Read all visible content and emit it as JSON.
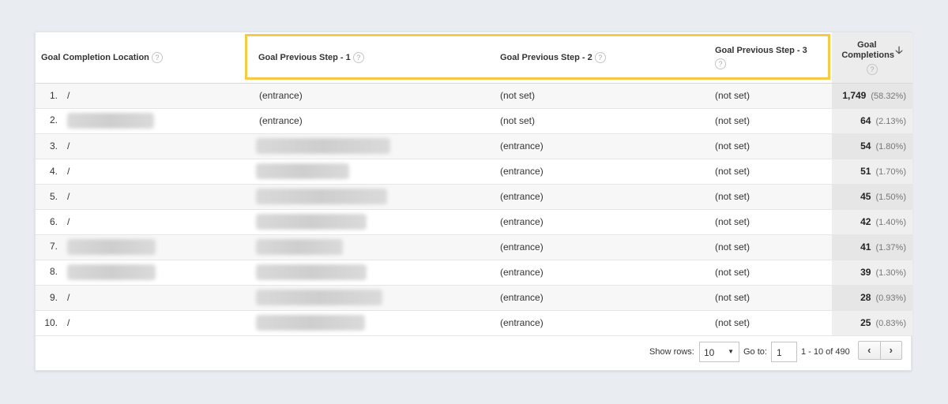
{
  "table": {
    "headers": {
      "location": "Goal Completion Location",
      "step1": "Goal Previous Step - 1",
      "step2": "Goal Previous Step - 2",
      "step3": "Goal Previous Step - 3",
      "completions": "Goal Completions",
      "help_glyph": "?",
      "sort_glyph": "🡣"
    },
    "rows": [
      {
        "rank": "1.",
        "location": "/",
        "step1": "(entrance)",
        "step2": "(not set)",
        "step3": "(not set)",
        "value": "1,749",
        "pct": "(58.32%)"
      },
      {
        "rank": "2.",
        "location": "",
        "step1": "(entrance)",
        "step2": "(not set)",
        "step3": "(not set)",
        "value": "64",
        "pct": "(2.13%)"
      },
      {
        "rank": "3.",
        "location": "/",
        "step1": "",
        "step2": "(entrance)",
        "step3": "(not set)",
        "value": "54",
        "pct": "(1.80%)"
      },
      {
        "rank": "4.",
        "location": "/",
        "step1": "",
        "step2": "(entrance)",
        "step3": "(not set)",
        "value": "51",
        "pct": "(1.70%)"
      },
      {
        "rank": "5.",
        "location": "/",
        "step1": "",
        "step2": "(entrance)",
        "step3": "(not set)",
        "value": "45",
        "pct": "(1.50%)"
      },
      {
        "rank": "6.",
        "location": "/",
        "step1": "",
        "step2": "(entrance)",
        "step3": "(not set)",
        "value": "42",
        "pct": "(1.40%)"
      },
      {
        "rank": "7.",
        "location": "",
        "step1": "",
        "step2": "(entrance)",
        "step3": "(not set)",
        "value": "41",
        "pct": "(1.37%)"
      },
      {
        "rank": "8.",
        "location": "",
        "step1": "",
        "step2": "(entrance)",
        "step3": "(not set)",
        "value": "39",
        "pct": "(1.30%)"
      },
      {
        "rank": "9.",
        "location": "/",
        "step1": "",
        "step2": "(entrance)",
        "step3": "(not set)",
        "value": "28",
        "pct": "(0.93%)"
      },
      {
        "rank": "10.",
        "location": "/",
        "step1": "",
        "step2": "(entrance)",
        "step3": "(not set)",
        "value": "25",
        "pct": "(0.83%)"
      }
    ]
  },
  "pagination": {
    "show_rows_label": "Show rows:",
    "show_rows_value": "10",
    "goto_label": "Go to:",
    "goto_value": "1",
    "range_text": "1 - 10 of 490",
    "prev_glyph": "‹",
    "next_glyph": "›"
  },
  "colors": {
    "highlight": "#f8c945"
  }
}
